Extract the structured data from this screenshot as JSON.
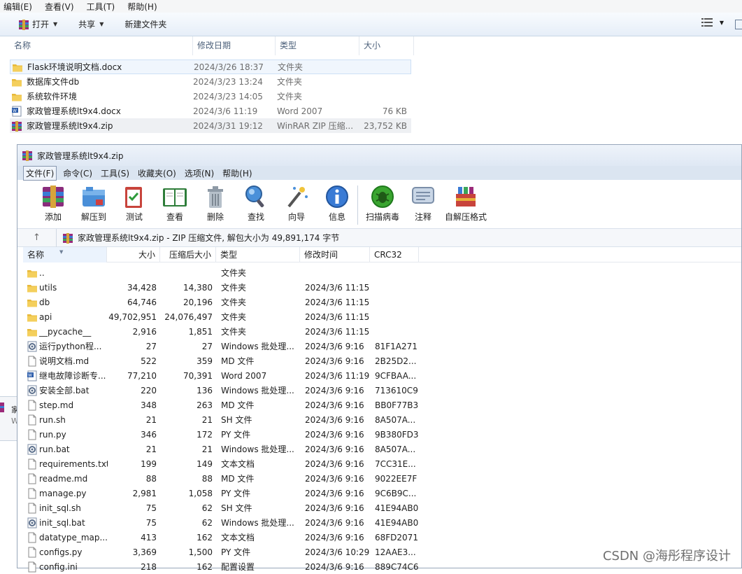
{
  "explorer": {
    "menu": [
      "编辑(E)",
      "查看(V)",
      "工具(T)",
      "帮助(H)"
    ],
    "toolbar": {
      "open_label": "打开",
      "share_label": "共享",
      "new_folder_label": "新建文件夹"
    },
    "columns": {
      "name": "名称",
      "date": "修改日期",
      "type": "类型",
      "size": "大小"
    },
    "rows": [
      {
        "icon": "folder-icon",
        "name": "Flask环境说明文档.docx",
        "date": "2024/3/26 18:37",
        "type": "文件夹",
        "size": ""
      },
      {
        "icon": "folder-icon",
        "name": "数据库文件db",
        "date": "2024/3/23 13:24",
        "type": "文件夹",
        "size": ""
      },
      {
        "icon": "folder-icon",
        "name": "系统软件环境",
        "date": "2024/3/23 14:05",
        "type": "文件夹",
        "size": ""
      },
      {
        "icon": "word-doc-icon",
        "name": "家政管理系统lt9x4.docx",
        "date": "2024/3/6 11:19",
        "type": "Word 2007",
        "size": "76 KB"
      },
      {
        "icon": "winrar-archive-icon",
        "name": "家政管理系统lt9x4.zip",
        "date": "2024/3/31 19:12",
        "type": "WinRAR ZIP 压缩...",
        "size": "23,752 KB"
      }
    ]
  },
  "winrar": {
    "title": "家政管理系统lt9x4.zip",
    "menu": [
      "文件(F)",
      "命令(C)",
      "工具(S)",
      "收藏夹(O)",
      "选项(N)",
      "帮助(H)"
    ],
    "tools": [
      "添加",
      "解压到",
      "测试",
      "查看",
      "删除",
      "查找",
      "向导",
      "信息",
      "扫描病毒",
      "注释",
      "自解压格式"
    ],
    "path_text": "家政管理系统lt9x4.zip - ZIP 压缩文件, 解包大小为 49,891,174 字节",
    "up_arrow": "↑",
    "columns": {
      "name": "名称",
      "size": "大小",
      "packed": "压缩后大小",
      "type": "类型",
      "modified": "修改时间",
      "crc": "CRC32"
    },
    "rows": [
      {
        "icon": "folder-icon",
        "name": "..",
        "size": "",
        "packed": "",
        "type": "文件夹",
        "modified": "",
        "crc": ""
      },
      {
        "icon": "folder-icon",
        "name": "utils",
        "size": "34,428",
        "packed": "14,380",
        "type": "文件夹",
        "modified": "2024/3/6 11:15",
        "crc": ""
      },
      {
        "icon": "folder-icon",
        "name": "db",
        "size": "64,746",
        "packed": "20,196",
        "type": "文件夹",
        "modified": "2024/3/6 11:15",
        "crc": ""
      },
      {
        "icon": "folder-icon",
        "name": "api",
        "size": "49,702,951",
        "packed": "24,076,497",
        "type": "文件夹",
        "modified": "2024/3/6 11:15",
        "crc": ""
      },
      {
        "icon": "folder-icon",
        "name": "__pycache__",
        "size": "2,916",
        "packed": "1,851",
        "type": "文件夹",
        "modified": "2024/3/6 11:15",
        "crc": ""
      },
      {
        "icon": "batch-file-icon",
        "name": "运行python程...",
        "size": "27",
        "packed": "27",
        "type": "Windows 批处理...",
        "modified": "2024/3/6 9:16",
        "crc": "81F1A271"
      },
      {
        "icon": "text-file-icon",
        "name": "说明文档.md",
        "size": "522",
        "packed": "359",
        "type": "MD 文件",
        "modified": "2024/3/6 9:16",
        "crc": "2B25D2..."
      },
      {
        "icon": "word-doc-icon",
        "name": "继电故障诊断专...",
        "size": "77,210",
        "packed": "70,391",
        "type": "Word 2007",
        "modified": "2024/3/6 11:19",
        "crc": "9CFBAA..."
      },
      {
        "icon": "batch-file-icon",
        "name": "安装全部.bat",
        "size": "220",
        "packed": "136",
        "type": "Windows 批处理...",
        "modified": "2024/3/6 9:16",
        "crc": "713610C9"
      },
      {
        "icon": "text-file-icon",
        "name": "step.md",
        "size": "348",
        "packed": "263",
        "type": "MD 文件",
        "modified": "2024/3/6 9:16",
        "crc": "BB0F77B3"
      },
      {
        "icon": "text-file-icon",
        "name": "run.sh",
        "size": "21",
        "packed": "21",
        "type": "SH 文件",
        "modified": "2024/3/6 9:16",
        "crc": "8A507A..."
      },
      {
        "icon": "text-file-icon",
        "name": "run.py",
        "size": "346",
        "packed": "172",
        "type": "PY 文件",
        "modified": "2024/3/6 9:16",
        "crc": "9B380FD3"
      },
      {
        "icon": "batch-file-icon",
        "name": "run.bat",
        "size": "21",
        "packed": "21",
        "type": "Windows 批处理...",
        "modified": "2024/3/6 9:16",
        "crc": "8A507A..."
      },
      {
        "icon": "text-file-icon",
        "name": "requirements.txt",
        "size": "199",
        "packed": "149",
        "type": "文本文档",
        "modified": "2024/3/6 9:16",
        "crc": "7CC31E..."
      },
      {
        "icon": "text-file-icon",
        "name": "readme.md",
        "size": "88",
        "packed": "88",
        "type": "MD 文件",
        "modified": "2024/3/6 9:16",
        "crc": "9022EE7F"
      },
      {
        "icon": "text-file-icon",
        "name": "manage.py",
        "size": "2,981",
        "packed": "1,058",
        "type": "PY 文件",
        "modified": "2024/3/6 9:16",
        "crc": "9C6B9C..."
      },
      {
        "icon": "text-file-icon",
        "name": "init_sql.sh",
        "size": "75",
        "packed": "62",
        "type": "SH 文件",
        "modified": "2024/3/6 9:16",
        "crc": "41E94AB0"
      },
      {
        "icon": "batch-file-icon",
        "name": "init_sql.bat",
        "size": "75",
        "packed": "62",
        "type": "Windows 批处理...",
        "modified": "2024/3/6 9:16",
        "crc": "41E94AB0"
      },
      {
        "icon": "text-file-icon",
        "name": "datatype_map....",
        "size": "413",
        "packed": "162",
        "type": "文本文档",
        "modified": "2024/3/6 9:16",
        "crc": "68FD2071"
      },
      {
        "icon": "text-file-icon",
        "name": "configs.py",
        "size": "3,369",
        "packed": "1,500",
        "type": "PY 文件",
        "modified": "2024/3/6 10:29",
        "crc": "12AAE3..."
      },
      {
        "icon": "text-file-icon",
        "name": "config.ini",
        "size": "218",
        "packed": "162",
        "type": "配置设置",
        "modified": "2024/3/6 9:16",
        "crc": "889C74C6"
      }
    ]
  },
  "side_fragment": {
    "t1": "家",
    "t2": "W"
  },
  "watermark": "CSDN @海彤程序设计",
  "colors": {
    "folder": "#e8b93a",
    "selection": "#cde0f5",
    "title_bar": "#dfe8f4"
  }
}
